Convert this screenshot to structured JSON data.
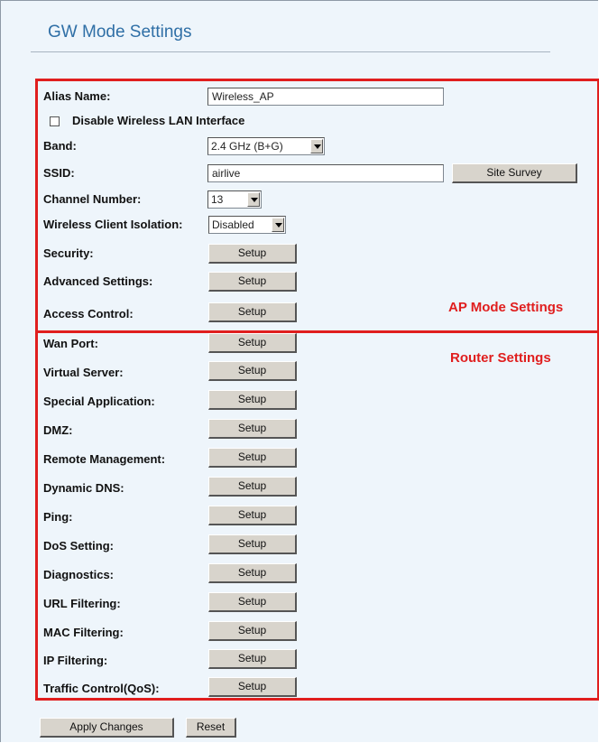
{
  "page": {
    "title": "GW Mode Settings"
  },
  "ap": {
    "alias_label": "Alias Name:",
    "alias_value": "Wireless_AP",
    "disable_label": "Disable Wireless LAN Interface",
    "band_label": "Band:",
    "band_value": "2.4 GHz (B+G)",
    "ssid_label": "SSID:",
    "ssid_value": "airlive",
    "site_survey_label": "Site Survey",
    "channel_label": "Channel Number:",
    "channel_value": "13",
    "isolation_label": "Wireless Client Isolation:",
    "isolation_value": "Disabled",
    "security_label": "Security:",
    "advanced_label": "Advanced Settings:",
    "access_label": "Access Control:",
    "section_note": "AP Mode Settings"
  },
  "router": {
    "section_note": "Router Settings",
    "wan_label": "Wan Port:",
    "virtual_label": "Virtual Server:",
    "special_label": "Special Application:",
    "dmz_label": "DMZ:",
    "remote_label": "Remote Management:",
    "ddns_label": "Dynamic DNS:",
    "ping_label": "Ping:",
    "dos_label": "DoS Setting:",
    "diag_label": "Diagnostics:",
    "url_label": "URL Filtering:",
    "mac_label": "MAC Filtering:",
    "ip_label": "IP Filtering:",
    "qos_label": "Traffic Control(QoS):"
  },
  "common": {
    "setup_label": "Setup"
  },
  "footer": {
    "apply_label": "Apply Changes",
    "reset_label": "Reset"
  }
}
